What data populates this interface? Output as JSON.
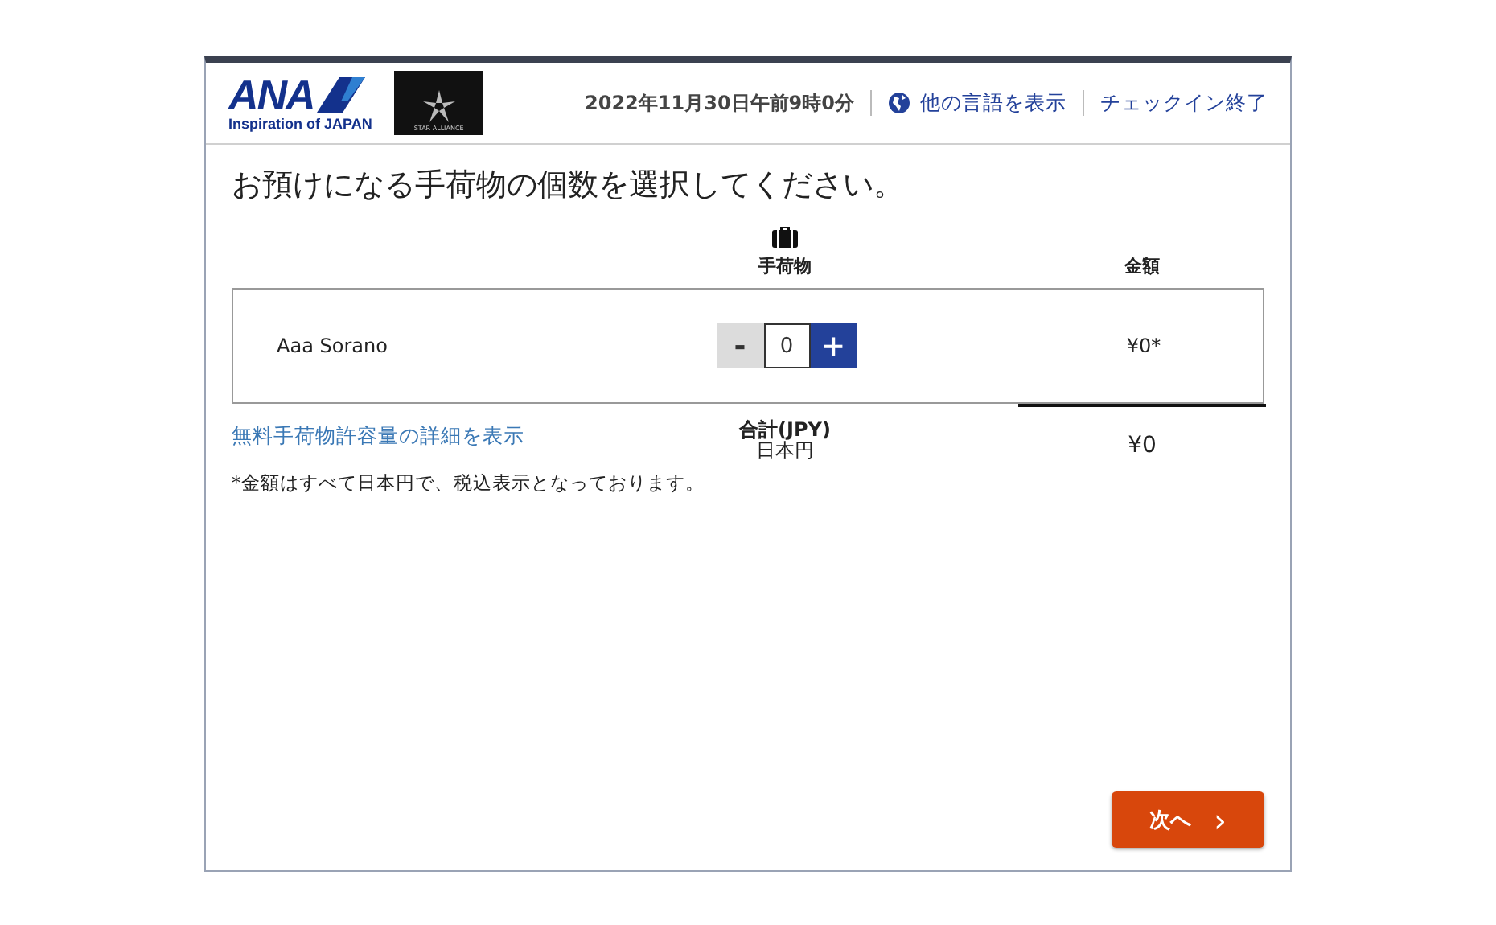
{
  "header": {
    "logo": {
      "text": "ANA",
      "tagline": "Inspiration of JAPAN"
    },
    "alliance_logo": {
      "text": "STAR ALLIANCE"
    },
    "datetime": "2022年11月30日午前9時0分",
    "language_link": "他の言語を表示",
    "exit_link": "チェックイン終了"
  },
  "heading": "お預けになる手荷物の個数を選択してください。",
  "table": {
    "columns": [
      "手荷物",
      "金額"
    ],
    "rows": [
      {
        "passenger": "Aaa Sorano",
        "decrement": {
          "label": "-",
          "disabled": true
        },
        "count": "0",
        "increment": {
          "label": "+",
          "disabled": false
        },
        "amount": "¥0*"
      }
    ]
  },
  "allowance_link": "無料手荷物許容量の詳細を表示",
  "total": {
    "label": "合計(JPY)",
    "currency": "日本円",
    "amount": "¥0"
  },
  "note": "*金額はすべて日本円で、税込表示となっております。",
  "next_button": {
    "label": "次へ",
    "icon": "›"
  }
}
